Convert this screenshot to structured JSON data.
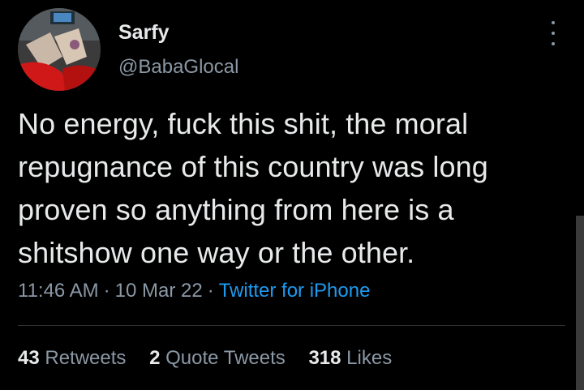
{
  "author": {
    "name": "Sarfy",
    "handle": "@BabaGlocal"
  },
  "tweet": {
    "text": "No energy, fuck this shit, the moral\nrepugnance of this country was long\nproven so anything from here is a\nshitshow one way or the other.",
    "time": "11:46 AM",
    "separator": "·",
    "date": "10 Mar 22",
    "source": "Twitter for iPhone"
  },
  "stats": {
    "retweets_count": "43",
    "retweets_label": "Retweets",
    "quotes_count": "2",
    "quotes_label": "Quote Tweets",
    "likes_count": "318",
    "likes_label": "Likes"
  },
  "colors": {
    "background": "#000000",
    "text": "#e7e9ea",
    "secondary": "#8b98a5",
    "link": "#1d9bf0",
    "divider": "#2f3336"
  },
  "icons": {
    "more": "more-vertical-icon"
  }
}
